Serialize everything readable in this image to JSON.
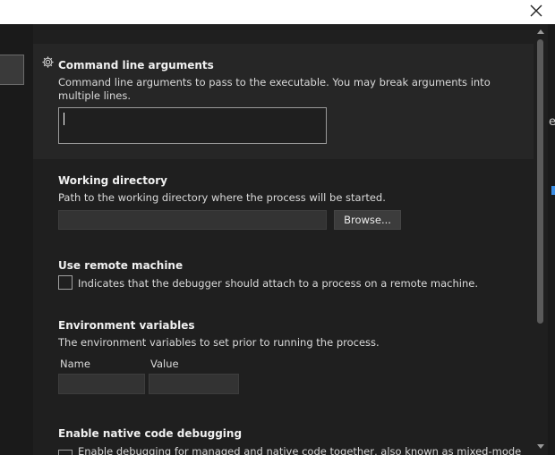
{
  "sections": {
    "command_line": {
      "title": "Command line arguments",
      "description": "Command line arguments to pass to the executable. You may break arguments into multiple lines.",
      "value": ""
    },
    "working_directory": {
      "title": "Working directory",
      "description": "Path to the working directory where the process will be started.",
      "value": "",
      "browse_label": "Browse..."
    },
    "remote_machine": {
      "title": "Use remote machine",
      "checkbox_label": "Indicates that the debugger should attach to a process on a remote machine.",
      "checked": false
    },
    "environment": {
      "title": "Environment variables",
      "description": "The environment variables to set prior to running the process.",
      "name_header": "Name",
      "value_header": "Value"
    },
    "native_debugging": {
      "title": "Enable native code debugging",
      "checkbox_label": "Enable debugging for managed and native code together, also known as mixed-mode"
    }
  },
  "right_fragment": "e",
  "icons": {
    "close": "close-icon",
    "settings": "gear-icon"
  }
}
